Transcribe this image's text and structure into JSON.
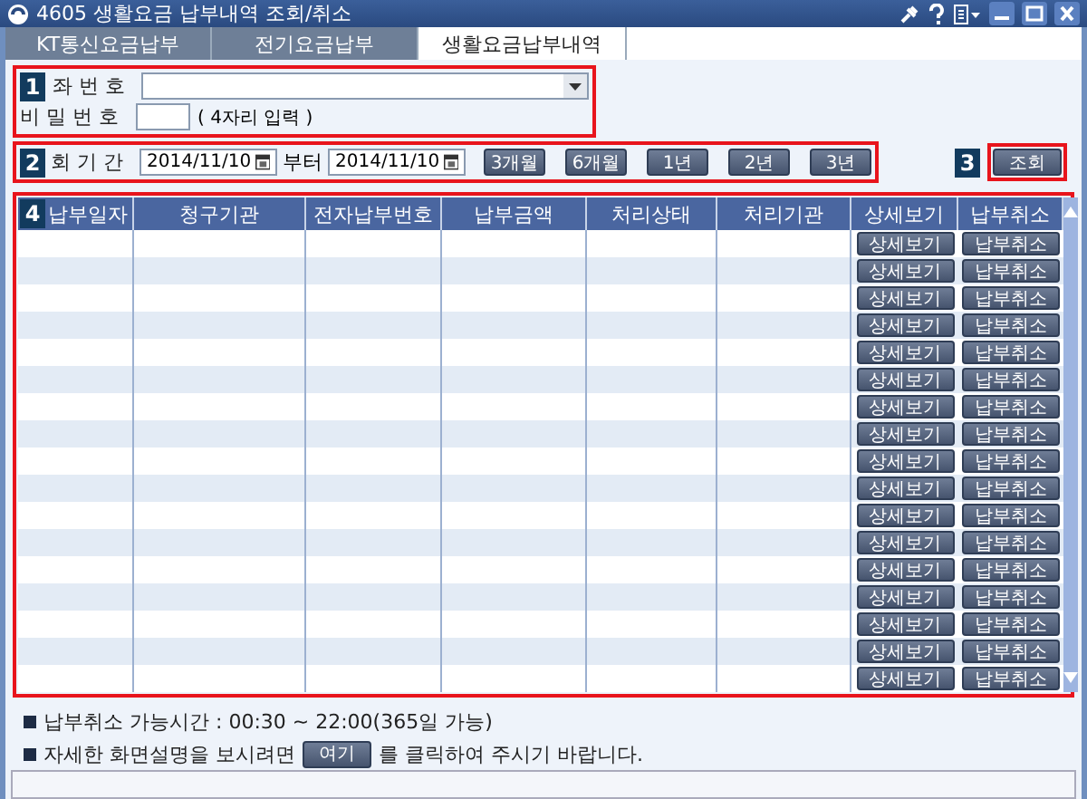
{
  "window": {
    "title": "4605 생활요금 납부내역 조회/취소"
  },
  "tabs": [
    {
      "label": "KT통신요금납부",
      "selected": false
    },
    {
      "label": "전기요금납부",
      "selected": false
    },
    {
      "label": "생활요금납부내역",
      "selected": true
    }
  ],
  "form": {
    "markers": [
      "1",
      "2",
      "3",
      "4"
    ],
    "account": {
      "label": "좌 번 호"
    },
    "password": {
      "label": "비 밀 번 호",
      "hint": "( 4자리 입력 )"
    },
    "period": {
      "label": "회 기 간",
      "from": "2014/11/10",
      "between": "부터",
      "to": "2014/11/10",
      "ranges": [
        "3개월",
        "6개월",
        "1년",
        "2년",
        "3년"
      ]
    },
    "search_button": "조회"
  },
  "table": {
    "columns": [
      "납부일자",
      "청구기관",
      "전자납부번호",
      "납부금액",
      "처리상태",
      "처리기관",
      "상세보기",
      "납부취소"
    ],
    "rows": [
      {
        "detail": "상세보기",
        "cancel": "납부취소"
      },
      {
        "detail": "상세보기",
        "cancel": "납부취소"
      },
      {
        "detail": "상세보기",
        "cancel": "납부취소"
      },
      {
        "detail": "상세보기",
        "cancel": "납부취소"
      },
      {
        "detail": "상세보기",
        "cancel": "납부취소"
      },
      {
        "detail": "상세보기",
        "cancel": "납부취소"
      },
      {
        "detail": "상세보기",
        "cancel": "납부취소"
      },
      {
        "detail": "상세보기",
        "cancel": "납부취소"
      },
      {
        "detail": "상세보기",
        "cancel": "납부취소"
      },
      {
        "detail": "상세보기",
        "cancel": "납부취소"
      },
      {
        "detail": "상세보기",
        "cancel": "납부취소"
      },
      {
        "detail": "상세보기",
        "cancel": "납부취소"
      },
      {
        "detail": "상세보기",
        "cancel": "납부취소"
      },
      {
        "detail": "상세보기",
        "cancel": "납부취소"
      },
      {
        "detail": "상세보기",
        "cancel": "납부취소"
      },
      {
        "detail": "상세보기",
        "cancel": "납부취소"
      },
      {
        "detail": "상세보기",
        "cancel": "납부취소"
      }
    ]
  },
  "notes": [
    {
      "text": "납부취소 가능시간 : 00:30 ~ 22:00(365일 가능)"
    },
    {
      "before": "자세한 화면설명을 보시려면",
      "link": "여기",
      "after": "를 클릭하여 주시기 바랍니다."
    }
  ]
}
